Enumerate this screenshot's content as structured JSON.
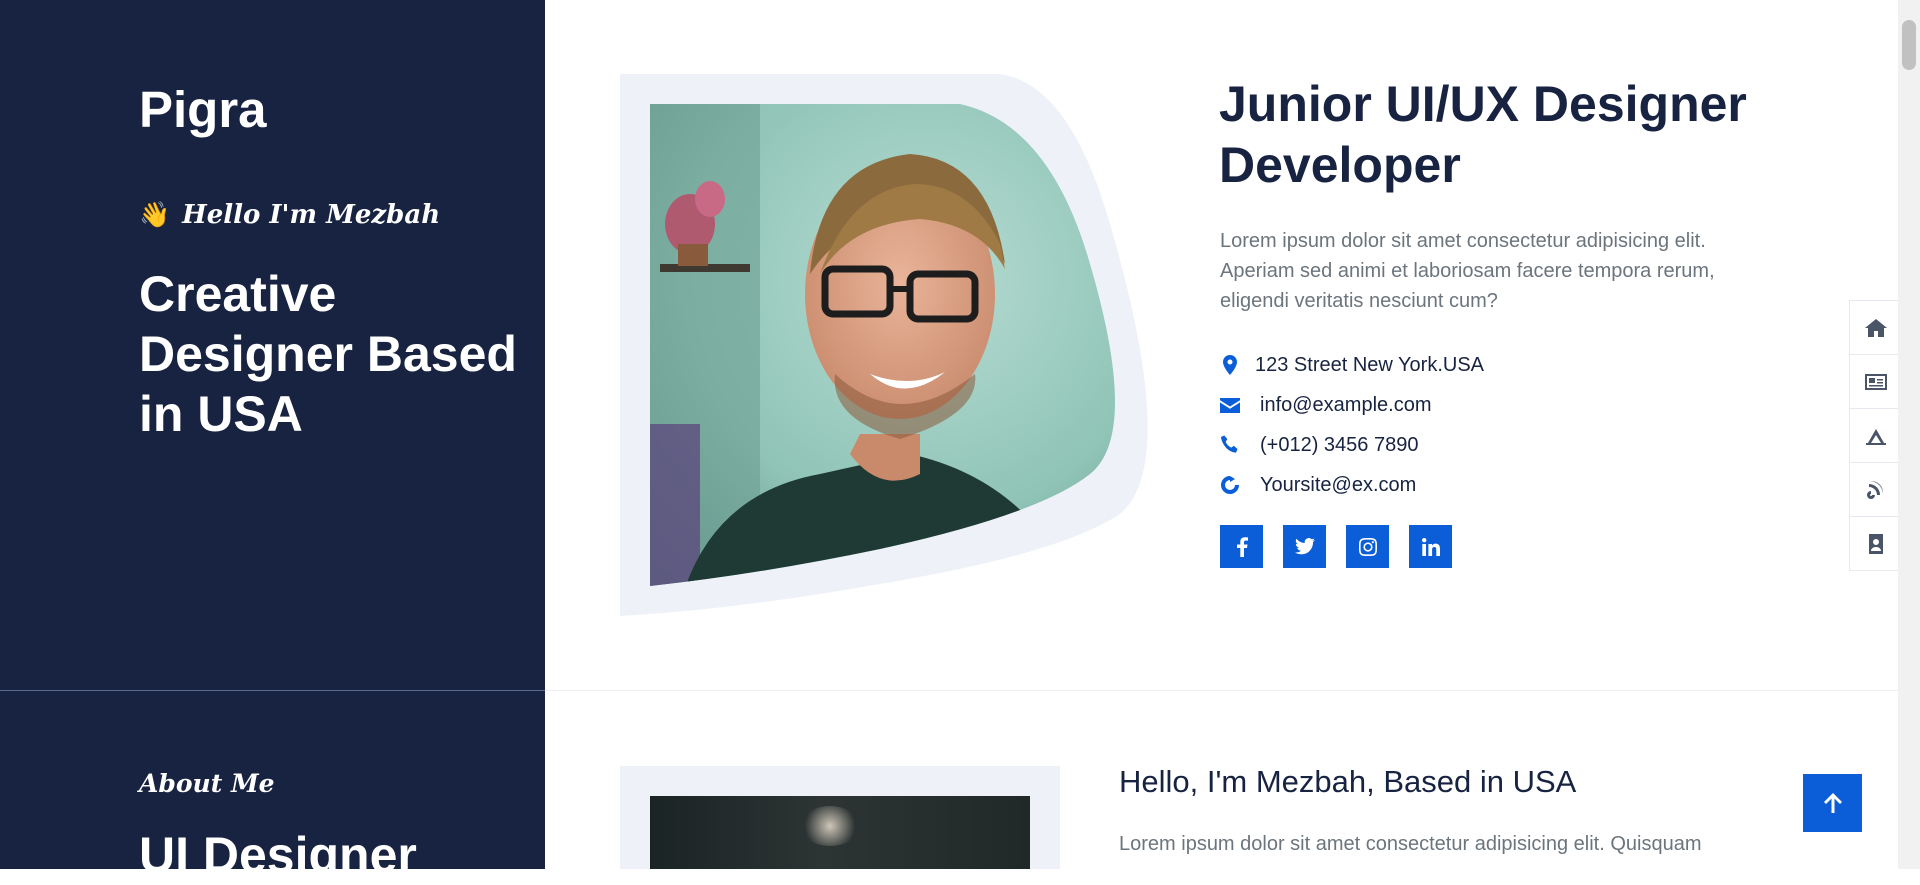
{
  "brand": "Pigra",
  "hero": {
    "greeting": "Hello I'm Mezbah",
    "greeting_icon": "👋",
    "headline": "Creative Designer Based in USA",
    "job_title": "Junior UI/UX Designer Developer",
    "intro": "Lorem ipsum dolor sit amet consectetur adipisicing elit. Aperiam sed animi et laboriosam facere tempora rerum, eligendi veritatis nesciunt cum?",
    "contacts": [
      {
        "icon": "map-marker-icon",
        "text": "123 Street New York.USA"
      },
      {
        "icon": "envelope-icon",
        "text": "info@example.com"
      },
      {
        "icon": "phone-icon",
        "text": "(+012) 3456 7890"
      },
      {
        "icon": "globe-icon",
        "text": "Yoursite@ex.com"
      }
    ],
    "socials": [
      "facebook-icon",
      "twitter-icon",
      "instagram-icon",
      "linkedin-icon"
    ]
  },
  "side_nav": [
    "home-icon",
    "id-card-icon",
    "services-icon",
    "blog-icon",
    "contact-book-icon"
  ],
  "about": {
    "kicker": "About Me",
    "title": "UI Designer",
    "heading": "Hello, I'm Mezbah, Based in USA",
    "text": "Lorem ipsum dolor sit amet consectetur adipisicing elit. Quisquam"
  },
  "colors": {
    "sidebar": "#172341",
    "accent": "#0b5ed7",
    "text_dark": "#172341",
    "text_muted": "#6c757d",
    "photo_frame": "#eef2f8"
  }
}
